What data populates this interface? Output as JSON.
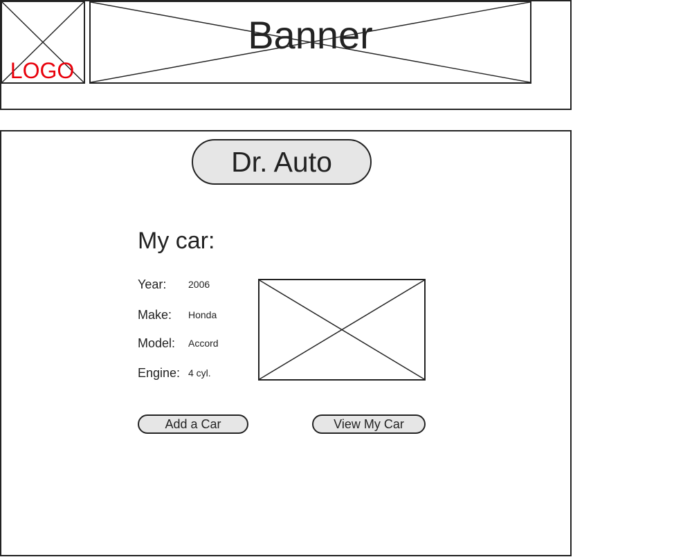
{
  "header": {
    "logo_text": "LOGO",
    "banner_text": "Banner",
    "logo_color": "#e8000b"
  },
  "main": {
    "app_title": "Dr. Auto",
    "section_heading": "My car:",
    "car_details": [
      {
        "label": "Year:",
        "value": "2006"
      },
      {
        "label": "Make:",
        "value": "Honda"
      },
      {
        "label": "Model:",
        "value": "Accord"
      },
      {
        "label": "Engine:",
        "value": "4 cyl."
      }
    ],
    "car_image_icon": "image-placeholder-icon",
    "buttons": {
      "add_car": "Add a Car",
      "view_car": "View My Car"
    }
  },
  "colors": {
    "border": "#222222",
    "button_fill": "#e6e6e6",
    "background": "#ffffff"
  }
}
